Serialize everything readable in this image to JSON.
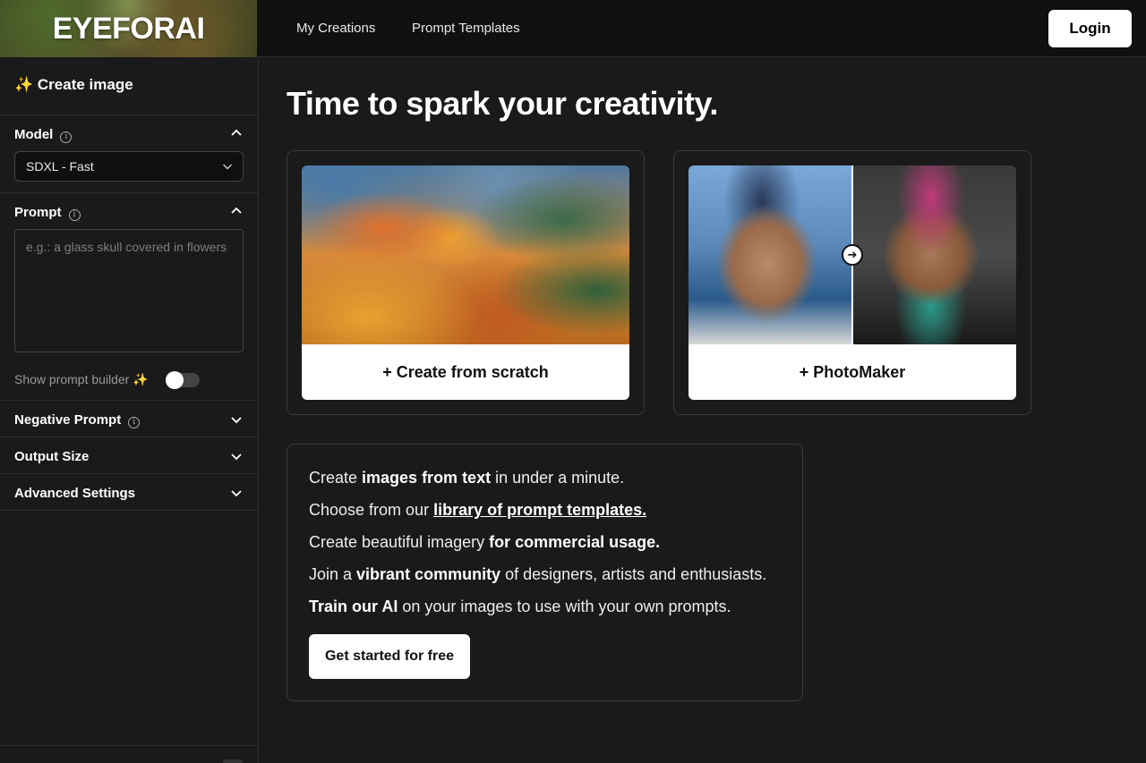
{
  "header": {
    "logo": "EYEFORAI",
    "nav": [
      "My Creations",
      "Prompt Templates"
    ],
    "login_label": "Login"
  },
  "sidebar": {
    "title": "✨ Create image",
    "model": {
      "label": "Model",
      "info": "i",
      "value": "SDXL - Fast"
    },
    "prompt": {
      "label": "Prompt",
      "info": "i",
      "placeholder": "e.g.: a glass skull covered in flowers"
    },
    "prompt_builder": {
      "label": "Show prompt builder ✨",
      "enabled": false
    },
    "negative_prompt": {
      "label": "Negative Prompt",
      "info": "i"
    },
    "output_size": {
      "label": "Output Size"
    },
    "advanced_settings": {
      "label": "Advanced Settings"
    }
  },
  "main": {
    "hero": "Time to spark your creativity.",
    "cards": [
      {
        "label": "+ Create from scratch"
      },
      {
        "label": "+ PhotoMaker"
      }
    ],
    "info": {
      "line1": {
        "pre": "Create ",
        "bold": "images from text",
        "post": " in under a minute."
      },
      "line2": {
        "pre": "Choose from our ",
        "link": "library of prompt templates."
      },
      "line3": {
        "pre": "Create beautiful imagery ",
        "bold": "for commercial usage."
      },
      "line4": {
        "pre": "Join a ",
        "bold": "vibrant community",
        "post": " of designers, artists and enthusiasts."
      },
      "line5": {
        "bold": "Train our AI",
        "post": " on your images to use with your own prompts."
      },
      "cta_label": "Get started for free"
    }
  },
  "colors": {
    "background": "#1a1a1a",
    "header": "#101010",
    "border": "#2e2e2e",
    "button": "#ffffff"
  }
}
